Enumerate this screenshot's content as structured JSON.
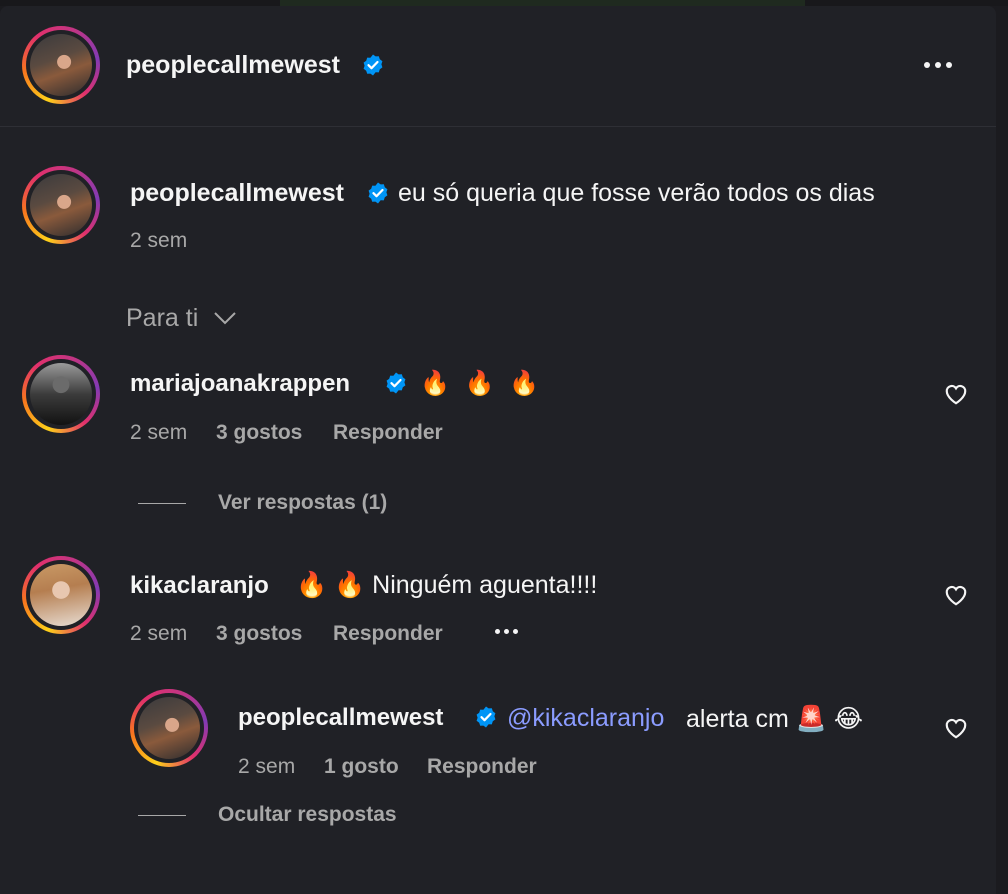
{
  "header": {
    "username": "peoplecallmewest",
    "more_icon": "more-horizontal-icon"
  },
  "caption": {
    "username": "peoplecallmewest",
    "text": "eu só queria que fosse verão todos os dias",
    "time": "2 sem"
  },
  "sort": {
    "label": "Para ti",
    "icon": "chevron-down-icon"
  },
  "comments": [
    {
      "username": "mariajoanakrappen",
      "verified": true,
      "text": "🔥 🔥 🔥",
      "time": "2 sem",
      "likes": "3 gostos",
      "reply_label": "Responder",
      "view_replies": "Ver respostas (1)"
    },
    {
      "username": "kikaclaranjo",
      "verified": false,
      "text": "🔥 🔥 Ninguém aguenta!!!!",
      "time": "2 sem",
      "likes": "3 gostos",
      "reply_label": "Responder",
      "hide_replies": "Ocultar respostas",
      "replies": [
        {
          "username": "peoplecallmewest",
          "verified": true,
          "mention": "@kikaclaranjo",
          "text": "alerta cm 🚨 😂",
          "time": "2 sem",
          "likes": "1 gosto",
          "reply_label": "Responder"
        }
      ]
    }
  ],
  "colors": {
    "background": "#202126",
    "text": "#f5f5f5",
    "muted": "#a8a8a8",
    "verified": "#0095f6",
    "mention": "#8b9cff"
  }
}
